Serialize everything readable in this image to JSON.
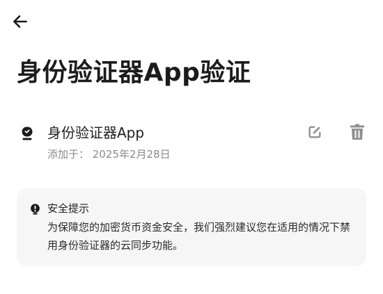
{
  "header": {
    "back_icon": "arrow-left-icon",
    "title": "身份验证器App验证"
  },
  "authenticator": {
    "icon": "authenticator-icon",
    "name": "身份验证器App",
    "added_label": "添加于：",
    "added_date": "2025年2月28日",
    "added_text": "添加于： 2025年2月28日",
    "edit_icon": "edit-icon",
    "delete_icon": "trash-icon"
  },
  "notice": {
    "icon": "security-tip-icon",
    "title": "安全提示",
    "body": "为保障您的加密货币资金安全，我们强烈建议您在适用的情况下禁用身份验证器的云同步功能。"
  }
}
